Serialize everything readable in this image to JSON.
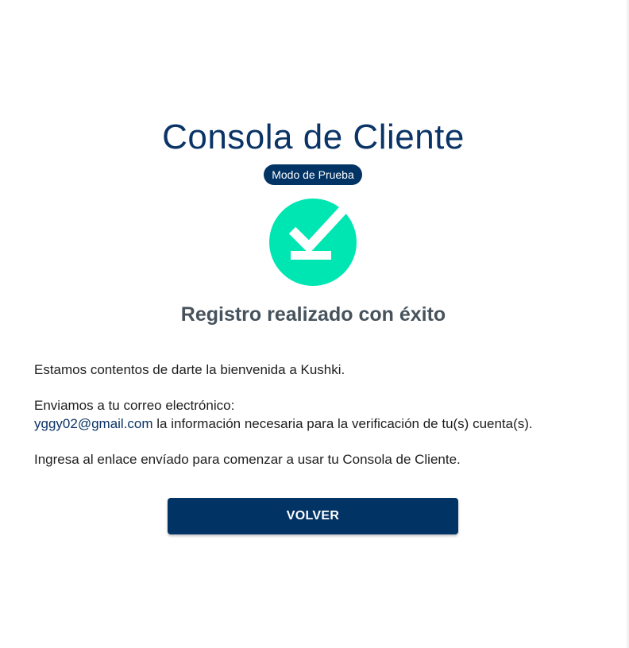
{
  "header": {
    "title": "Consola de Cliente",
    "mode_badge": "Modo de Prueba"
  },
  "status": {
    "icon": "success-check-icon",
    "icon_color": "#00e6b2",
    "title": "Registro realizado con éxito"
  },
  "message": {
    "welcome": "Estamos contentos de darte la bienvenida a Kushki.",
    "email_intro": "Enviamos a tu correo electrónico:",
    "email": "yggy02@gmail.com",
    "email_suffix": " la información necesaria para la verificación de tu(s) cuenta(s).",
    "instructions": "Ingresa al enlace envíado para comenzar a usar tu Consola de Cliente."
  },
  "actions": {
    "back_label": "VOLVER"
  },
  "colors": {
    "primary": "#023365",
    "title_text": "#0b3466",
    "subtitle_text": "#46525c",
    "success": "#00e6b2"
  }
}
